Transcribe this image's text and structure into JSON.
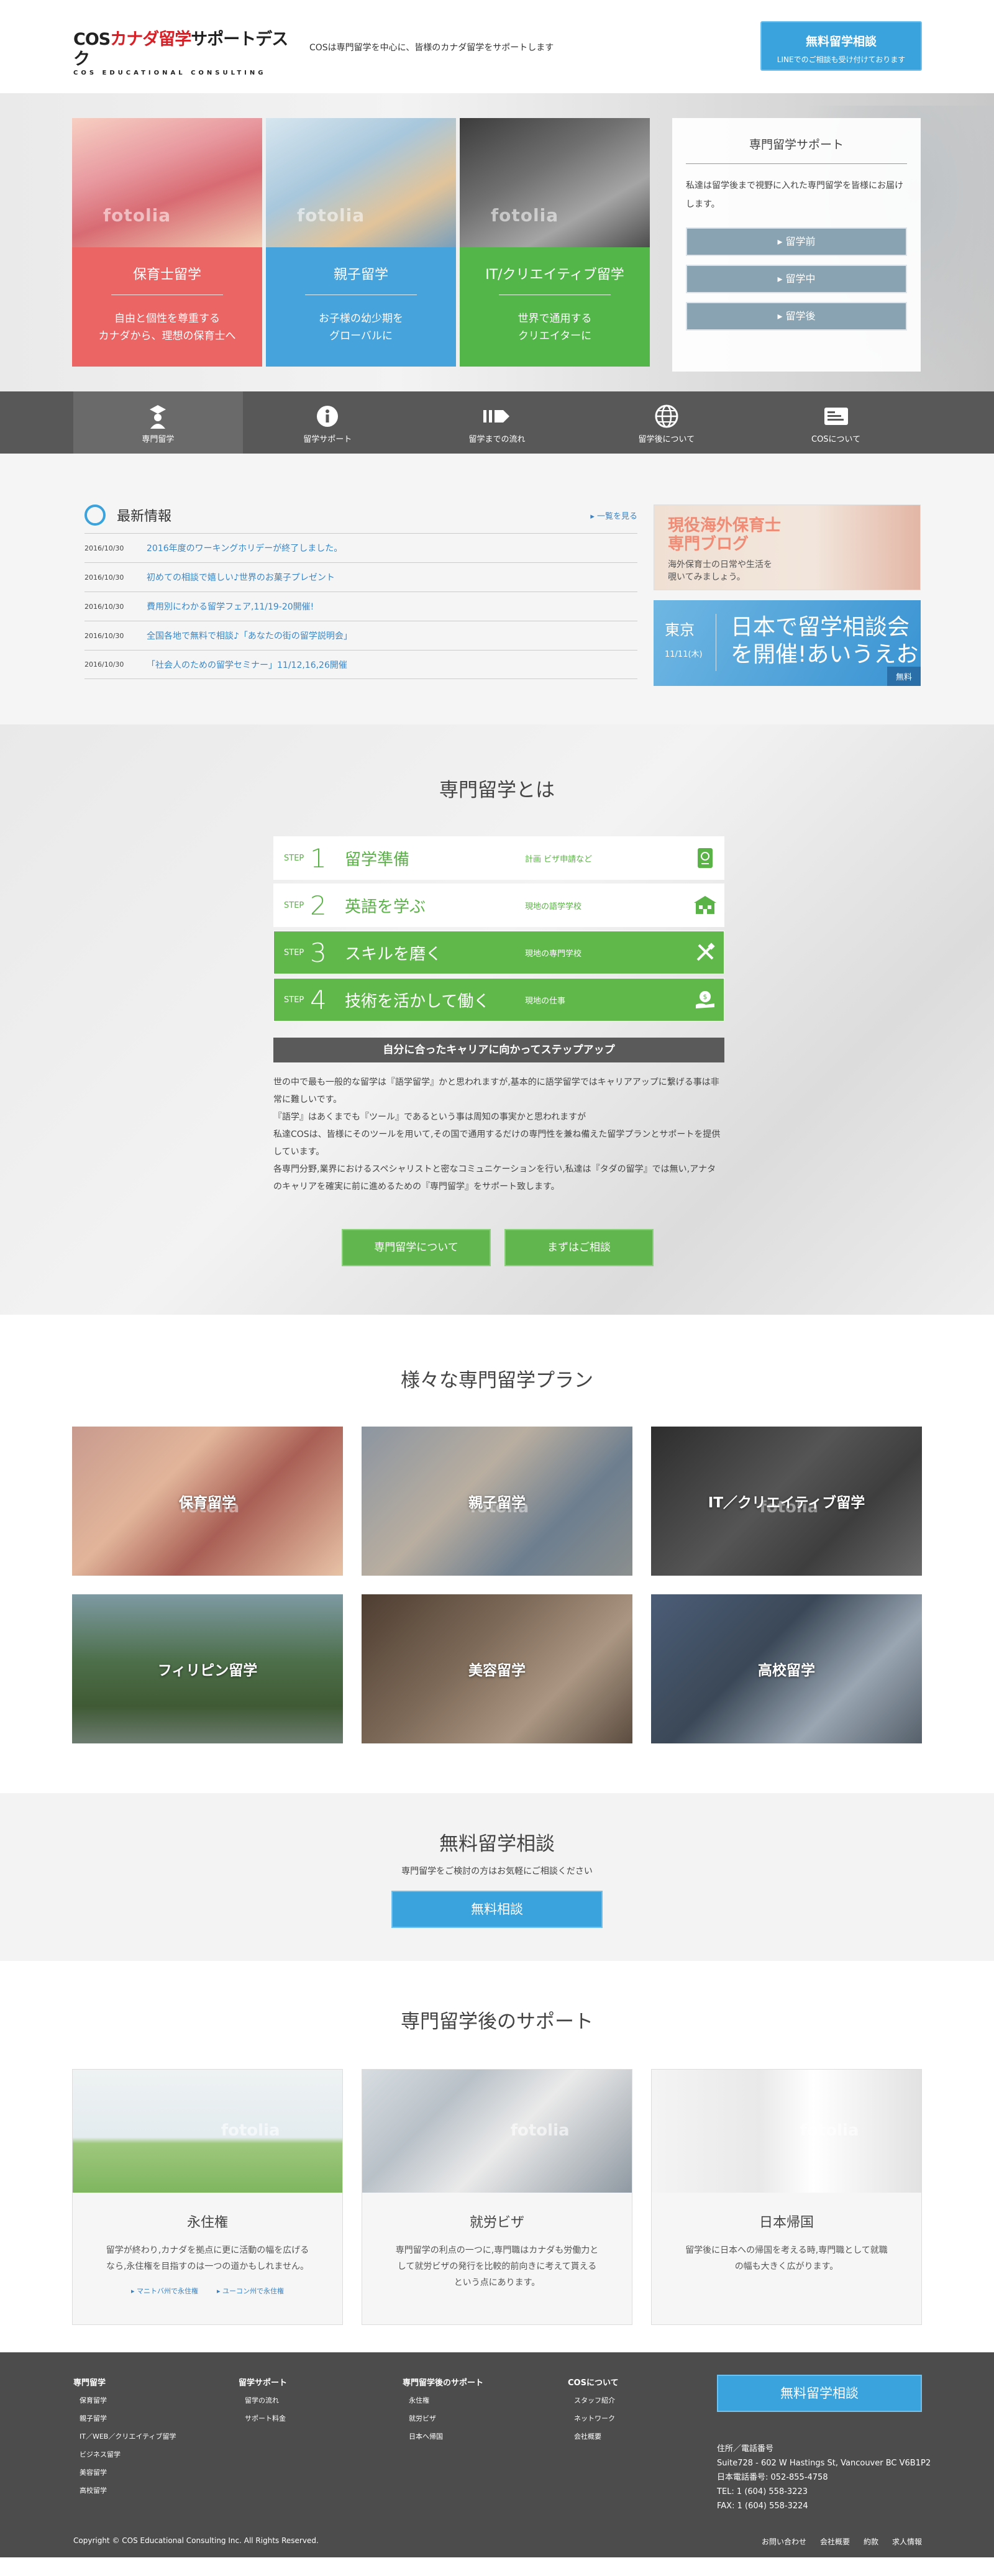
{
  "header": {
    "logo_main_black": "COS",
    "logo_main_red": "カナダ留学",
    "logo_main_rest": "サポートデスク",
    "logo_sub": "COS EDUCATIONAL CONSULTING",
    "tagline": "COSは専門留学を中心に、皆様のカナダ留学をサポートします",
    "cta_title": "無料留学相談",
    "cta_sub": "LINEでのご相談も受け付けております"
  },
  "hero": {
    "cards": [
      {
        "title": "保育士留学",
        "desc1": "自由と個性を尊重する",
        "desc2": "カナダから、理想の保育士へ",
        "watermark": "fotolia"
      },
      {
        "title": "親子留学",
        "desc1": "お子様の幼少期を",
        "desc2": "グローバルに",
        "watermark": "fotolia"
      },
      {
        "title": "IT/クリエイティブ留学",
        "desc1": "世界で通用する",
        "desc2": "クリエイターに",
        "watermark": "fotolia"
      }
    ],
    "support": {
      "title": "専門留学サポート",
      "text": "私達は留学後まで視野に入れた専門留学を皆様にお届けします。",
      "buttons": [
        "▸ 留学前",
        "▸ 留学中",
        "▸ 留学後"
      ]
    }
  },
  "nav": {
    "items": [
      "専門留学",
      "留学サポート",
      "留学までの流れ",
      "留学後について",
      "COSについて"
    ]
  },
  "news": {
    "title": "最新情報",
    "more": "▸ 一覧を見る",
    "items": [
      {
        "date": "2016/10/30",
        "text": "2016年度のワーキングホリデーが終了しました。"
      },
      {
        "date": "2016/10/30",
        "text": "初めての相談で嬉しい♪世界のお菓子プレゼント"
      },
      {
        "date": "2016/10/30",
        "text": "費用別にわかる留学フェア,11/19-20開催!"
      },
      {
        "date": "2016/10/30",
        "text": "全国各地で無料で相談♪「あなたの街の留学説明会」"
      },
      {
        "date": "2016/10/30",
        "text": "「社会人のための留学セミナー」11/12,16,26開催"
      }
    ],
    "ad_blog": {
      "title1": "現役海外保育士",
      "title2": "専門ブログ",
      "text1": "海外保育士の日常や生活を",
      "text2": "覗いてみましょう。"
    },
    "ad_event": {
      "city": "東京",
      "date": "11/11(木)",
      "main1": "日本で留学相談会",
      "main2": "を開催!あいうえお",
      "badge": "無料"
    }
  },
  "about": {
    "title": "専門留学とは",
    "steps": [
      {
        "label": "STEP",
        "num": "1",
        "name": "留学準備",
        "sub": "計画 ビザ申請など"
      },
      {
        "label": "STEP",
        "num": "2",
        "name": "英語を学ぶ",
        "sub": "現地の語学学校"
      },
      {
        "label": "STEP",
        "num": "3",
        "name": "スキルを磨く",
        "sub": "現地の専門学校"
      },
      {
        "label": "STEP",
        "num": "4",
        "name": "技術を活かして働く",
        "sub": "現地の仕事"
      }
    ],
    "summary": "自分に合ったキャリアに向かってステップアップ",
    "paragraphs": [
      "世の中で最も一般的な留学は『語学留学』かと思われますが,基本的に語学留学ではキャリアアップに繋げる事は非常に難しいです。",
      "『語学』はあくまでも『ツール』であるという事は周知の事実かと思われますが",
      "私達COSは、皆様にそのツールを用いて,その国で通用するだけの専門性を兼ね備えた留学プランとサポートを提供しています。",
      "各専門分野,業界におけるスペシャリストと密なコミュニケーションを行い,私達は『タダの留学』では無い,アナタのキャリアを確実に前に進めるための『専門留学』をサポート致します。"
    ],
    "btn1": "専門留学について",
    "btn2": "まずはご相談"
  },
  "plans": {
    "title": "様々な専門留学プラン",
    "items": [
      "保育留学",
      "親子留学",
      "IT／クリエイティブ留学",
      "フィリピン留学",
      "美容留学",
      "高校留学"
    ],
    "watermark": "fotolia"
  },
  "consult": {
    "title": "無料留学相談",
    "sub": "専門留学をご検討の方はお気軽にご相談ください",
    "button": "無料相談"
  },
  "after": {
    "title": "専門留学後のサポート",
    "watermark": "fotolia",
    "cards": [
      {
        "title": "永住権",
        "desc": "留学が終わり,カナダを拠点に更に活動の幅を広げるなら,永住権を目指すのは一つの道かもしれません。",
        "links": [
          "▸ マニトバ州で永住権",
          "▸ ユーコン州で永住権"
        ]
      },
      {
        "title": "就労ビザ",
        "desc": "専門留学の利点の一つに,専門職はカナダも労働力として就労ビザの発行を比較的前向きに考えて貰えるという点にあります。",
        "links": []
      },
      {
        "title": "日本帰国",
        "desc": "留学後に日本への帰国を考える時,専門職として就職の幅も大きく広がります。",
        "links": []
      }
    ]
  },
  "footer": {
    "cols": [
      {
        "heading": "専門留学",
        "items": [
          "保育留学",
          "親子留学",
          "IT／WEB／クリエイティブ留学",
          "ビジネス留学",
          "美容留学",
          "高校留学"
        ]
      },
      {
        "heading": "留学サポート",
        "items": [
          "留学の流れ",
          "サポート料金"
        ]
      },
      {
        "heading": "専門留学後のサポート",
        "items": [
          "永住権",
          "就労ビザ",
          "日本へ帰国"
        ]
      },
      {
        "heading": "COSについて",
        "items": [
          "スタッフ紹介",
          "ネットワーク",
          "会社概要"
        ]
      }
    ],
    "button": "無料留学相談",
    "address": {
      "label": "住所／電話番号",
      "line1": "Suite728 - 602 W Hastings St, Vancouver BC V6B1P2",
      "line2": "日本電話番号: 052-855-4758",
      "line3": "TEL: 1 (604) 558-3223",
      "line4": "FAX: 1 (604) 558-3224"
    },
    "copyright": "Copyright © COS Educational Consulting Inc. All Rights Reserved.",
    "links": [
      "お問い合わせ",
      "会社概要",
      "約款",
      "求人情報"
    ]
  },
  "colors": {
    "accent_blue": "#3aa3de",
    "green": "#61b64e",
    "red": "#ec6565",
    "dark_gray": "#4c4c4c"
  }
}
